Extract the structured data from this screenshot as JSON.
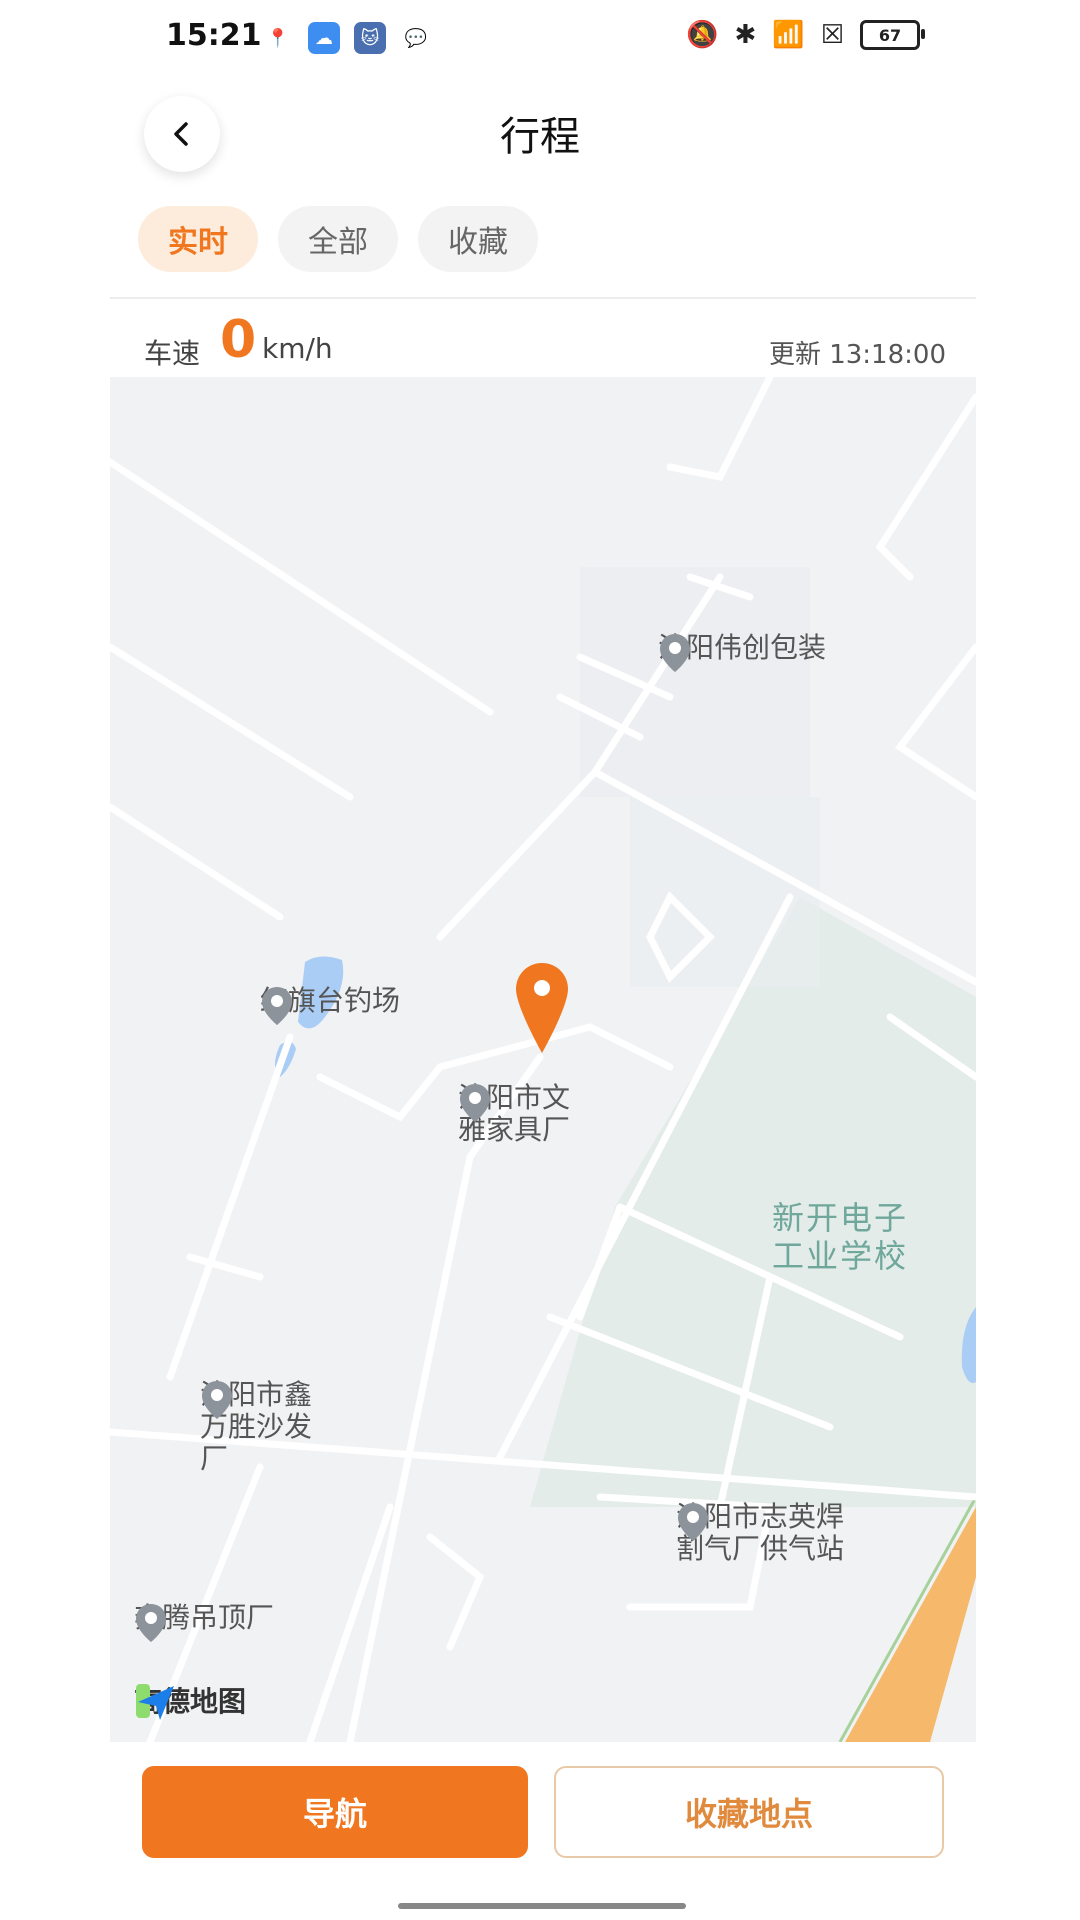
{
  "status_bar": {
    "time": "15:21",
    "battery": "67"
  },
  "header": {
    "title": "行程"
  },
  "tabs": [
    {
      "label": "实时",
      "active": true
    },
    {
      "label": "全部",
      "active": false
    },
    {
      "label": "收藏",
      "active": false
    }
  ],
  "speed": {
    "label": "车速",
    "value": "0",
    "unit": "km/h",
    "update_text": "更新 13:18:00"
  },
  "map": {
    "pois": [
      {
        "label": "沈阳伟创包装"
      },
      {
        "label": "红旗台钓场"
      },
      {
        "label": "沈阳市文雅家具厂"
      },
      {
        "label": "沈阳市鑫万胜沙发厂"
      },
      {
        "label": "沈阳市志英焊割气厂供气站"
      },
      {
        "label": "奔腾吊顶厂"
      }
    ],
    "area_label": "新开电子工业学校",
    "logo_text": "高德地图",
    "colors": {
      "background": "#f1f2f4",
      "road": "#ffffff",
      "green_area": "#e3ece8",
      "water": "#a9cdf5",
      "highway": "#f6b86a",
      "marker": "#f0771f"
    }
  },
  "buttons": {
    "navigate": "导航",
    "save_location": "收藏地点"
  },
  "colors": {
    "accent": "#f0771f",
    "tab_active_bg": "#fdecdc"
  }
}
